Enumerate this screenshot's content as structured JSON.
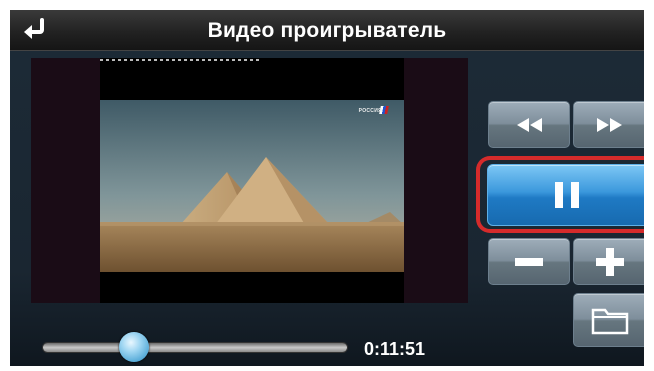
{
  "header": {
    "title": "Видео проигрыватель",
    "back_icon": "return-arrow-icon"
  },
  "video": {
    "channel_logo_text": "РОССИЯ"
  },
  "controls": {
    "rewind_icon": "rewind-icon",
    "fast_forward_icon": "fast-forward-icon",
    "pause_icon": "pause-icon",
    "volume_down_icon": "minus-icon",
    "volume_up_icon": "plus-icon",
    "folder_icon": "folder-icon",
    "highlight_color": "#d52b2b",
    "active_color": "#2f8fd8"
  },
  "playback": {
    "progress_fraction": 0.3,
    "time": "0:11:51"
  }
}
